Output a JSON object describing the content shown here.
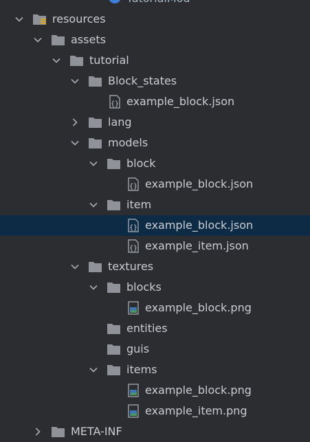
{
  "colors": {
    "background": "#2b2d30",
    "selected_row": "#0e2b45",
    "text": "#c9cdd3",
    "folder": "#8f9399",
    "resources_marker": "#d4a62a",
    "module_badge": "#3d7fd6",
    "image_green": "#4b9b5a",
    "image_blue": "#3e74b5"
  },
  "tree": {
    "top_item": {
      "label": "TutorialMod",
      "icon": "module-icon"
    },
    "items": [
      {
        "label": "resources",
        "icon": "resources-folder-icon",
        "arrow": "down"
      },
      {
        "label": "assets",
        "icon": "folder-icon",
        "arrow": "down"
      },
      {
        "label": "tutorial",
        "icon": "folder-icon",
        "arrow": "down"
      },
      {
        "label": "Block_states",
        "icon": "folder-icon",
        "arrow": "down"
      },
      {
        "label": "example_block.json",
        "icon": "json-file-icon",
        "arrow": "none"
      },
      {
        "label": "lang",
        "icon": "folder-icon",
        "arrow": "right"
      },
      {
        "label": "models",
        "icon": "folder-icon",
        "arrow": "down"
      },
      {
        "label": "block",
        "icon": "folder-icon",
        "arrow": "down"
      },
      {
        "label": "example_block.json",
        "icon": "json-file-icon",
        "arrow": "none"
      },
      {
        "label": "item",
        "icon": "folder-icon",
        "arrow": "down"
      },
      {
        "label": "example_block.json",
        "icon": "json-file-icon",
        "arrow": "none",
        "selected": true
      },
      {
        "label": "example_item.json",
        "icon": "json-file-icon",
        "arrow": "none"
      },
      {
        "label": "textures",
        "icon": "folder-icon",
        "arrow": "down"
      },
      {
        "label": "blocks",
        "icon": "folder-icon",
        "arrow": "down"
      },
      {
        "label": "example_block.png",
        "icon": "image-file-icon",
        "arrow": "none"
      },
      {
        "label": "entities",
        "icon": "folder-icon",
        "arrow": "none"
      },
      {
        "label": "guis",
        "icon": "folder-icon",
        "arrow": "none"
      },
      {
        "label": "items",
        "icon": "folder-icon",
        "arrow": "down"
      },
      {
        "label": "example_block.png",
        "icon": "image-file-icon",
        "arrow": "none"
      },
      {
        "label": "example_item.png",
        "icon": "image-file-icon",
        "arrow": "none"
      },
      {
        "label": "META-INF",
        "icon": "folder-icon",
        "arrow": "right"
      }
    ]
  }
}
